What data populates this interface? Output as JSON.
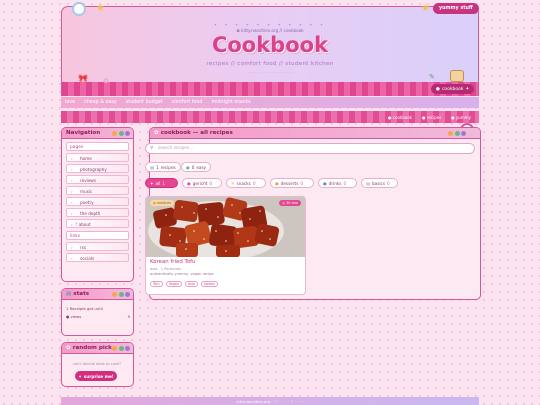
{
  "header": {
    "badge": "yummy stuff",
    "sparkles": "✦ ✦ ✦ ✦ ✦ ✦ ✦ ✦ ✦ ✦ ✦",
    "url": "✿ kitty.neocities.org // cookbook",
    "title": "Cookbook",
    "tags": "recipes  //  comfort food  //  student kitchen",
    "sub": "········  ··· ········  ·······  ···········",
    "pill": "cookbook"
  },
  "navbar": [
    "love",
    "cheap & easy",
    "student budget",
    "comfort food",
    "midnight snacks"
  ],
  "breadcrumb": [
    "cookbook",
    "recipes",
    "yummy"
  ],
  "sidebar": {
    "title": "Navigation",
    "pages_label": "pages",
    "pages": [
      "home",
      "photography",
      "reviews",
      "music",
      "poetry",
      "the depth",
      "about"
    ],
    "links_label": "links",
    "links": [
      "rss",
      "socials"
    ]
  },
  "stats": {
    "title": "stats",
    "line1": "1 Receipts got until",
    "line2": "views",
    "line2_value": "5"
  },
  "random": {
    "title": "random pick",
    "prompt": "can't decide what to cook?",
    "button": "surprise me!"
  },
  "main": {
    "title": "cookbook — all recipes",
    "search_placeholder": "search recipes...",
    "filter1": {
      "label": "recipes",
      "count": "1"
    },
    "filter2": {
      "label": "easy",
      "count": "0"
    },
    "categories": [
      {
        "label": "all",
        "count": "1",
        "active": true
      },
      {
        "label": "gericht",
        "count": "0"
      },
      {
        "label": "snacks",
        "count": "0"
      },
      {
        "label": "desserts",
        "count": "0"
      },
      {
        "label": "drinks",
        "count": "0"
      },
      {
        "label": "basics",
        "count": "0"
      }
    ],
    "card": {
      "badge_left": "medium",
      "badge_right": "30 min",
      "title": "Korean fried Tofu",
      "meta": "asia  ·  1 Portionen",
      "tags_line": "authentically yummy, vegan recipe",
      "tags": [
        "Tofu",
        "Vegan",
        "Asia",
        "korean"
      ]
    }
  },
  "footer": "kitty.neocities.org  ·  ♡  ·  · · ·  ·  ♡  ·  · · ·"
}
